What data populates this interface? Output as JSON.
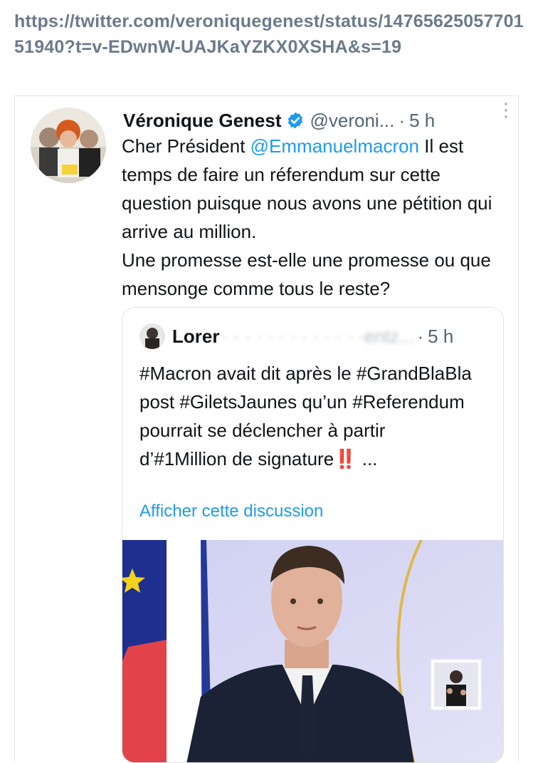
{
  "url": "https://twitter.com/veroniquegenest/status/1476562505770151940?t=v-EDwnW-UAJKaYZKX0XSHA&s=19",
  "tweet": {
    "author_name": "Véronique Genest",
    "handle": "@veroni...",
    "separator": "·",
    "time": "5 h",
    "more_glyph": "⋮",
    "body_part1": "Cher Président ",
    "mention": "@Emmanuelmacron",
    "body_part2": " Il est temps de faire un réferendum sur cette question puisque nous avons une pétition qui arrive au million.",
    "body_part3": "Une  promesse est-elle une promesse ou que mensonge comme tous le reste?"
  },
  "quoted_tweet": {
    "author_name_visible": "Lorer",
    "author_name_blurred": "· ·  · · ·  · ·  · · · · · ·entz...",
    "separator": "·",
    "time": "5 h",
    "body": "#Macron avait dit après le #GrandBlaBla post #GiletsJaunes qu’un #Referendum pourrait se déclencher à partir d’#1Million de signature‼️ ...",
    "show_thread_link": "Afficher cette discussion"
  },
  "icons": {
    "verified": "verified-badge-icon",
    "more": "more-vertical-icon"
  },
  "colors": {
    "url": "#6b7a8b",
    "link": "#1d9bf0",
    "muted": "#536471"
  }
}
